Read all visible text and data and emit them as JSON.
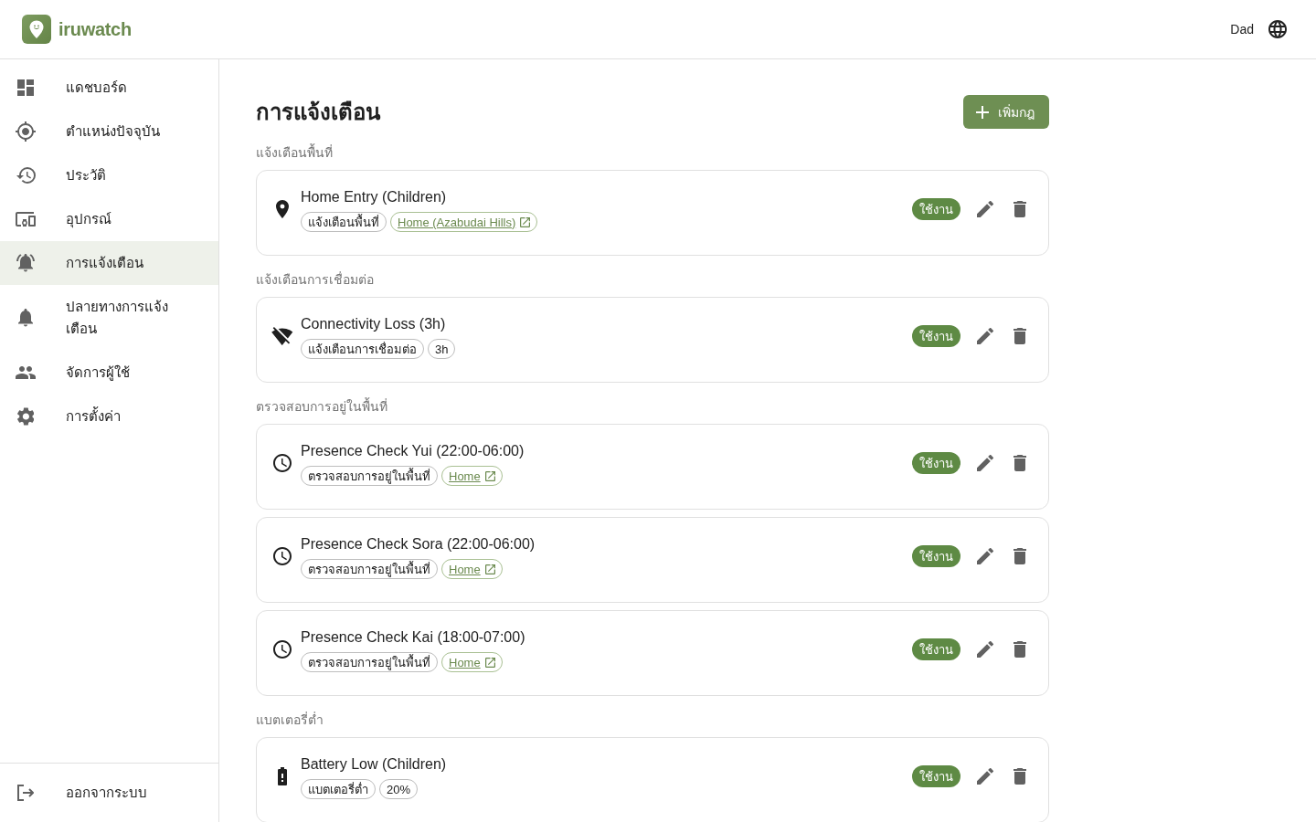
{
  "header": {
    "brand": "iruwatch",
    "user": "Dad"
  },
  "sidebar": {
    "items": [
      {
        "label": "แดชบอร์ด",
        "selected": false
      },
      {
        "label": "ตำแหน่งปัจจุบัน",
        "selected": false
      },
      {
        "label": "ประวัติ",
        "selected": false
      },
      {
        "label": "อุปกรณ์",
        "selected": false
      },
      {
        "label": "การแจ้งเตือน",
        "selected": true
      },
      {
        "label": "ปลายทางการแจ้งเตือน",
        "selected": false
      },
      {
        "label": "จัดการผู้ใช้",
        "selected": false
      },
      {
        "label": "การตั้งค่า",
        "selected": false
      }
    ],
    "logout": "ออกจากระบบ"
  },
  "page": {
    "title": "การแจ้งเตือน",
    "add_button": "เพิ่มกฎ"
  },
  "sections": [
    {
      "heading": "แจ้งเตือนพื้นที่",
      "rules": [
        {
          "kind": "geofence",
          "title": "Home Entry (Children)",
          "tags": [
            {
              "kind": "plain",
              "text": "แจ้งเตือนพื้นที่"
            },
            {
              "kind": "link",
              "text": "Home (Azabudai Hills)"
            }
          ],
          "status": {
            "label": "ใช้งาน",
            "on": true
          }
        }
      ]
    },
    {
      "heading": "แจ้งเตือนการเชื่อมต่อ",
      "rules": [
        {
          "kind": "connectivity",
          "title": "Connectivity Loss (3h)",
          "tags": [
            {
              "kind": "plain",
              "text": "แจ้งเตือนการเชื่อมต่อ"
            },
            {
              "kind": "plain",
              "text": "3h"
            }
          ],
          "status": {
            "label": "ใช้งาน",
            "on": true
          }
        }
      ]
    },
    {
      "heading": "ตรวจสอบการอยู่ในพื้นที่",
      "rules": [
        {
          "kind": "presence",
          "title": "Presence Check Yui (22:00-06:00)",
          "tags": [
            {
              "kind": "plain",
              "text": "ตรวจสอบการอยู่ในพื้นที่"
            },
            {
              "kind": "link",
              "text": "Home"
            }
          ],
          "status": {
            "label": "ใช้งาน",
            "on": true
          }
        },
        {
          "kind": "presence",
          "title": "Presence Check Sora (22:00-06:00)",
          "tags": [
            {
              "kind": "plain",
              "text": "ตรวจสอบการอยู่ในพื้นที่"
            },
            {
              "kind": "link",
              "text": "Home"
            }
          ],
          "status": {
            "label": "ใช้งาน",
            "on": true
          }
        },
        {
          "kind": "presence",
          "title": "Presence Check Kai (18:00-07:00)",
          "tags": [
            {
              "kind": "plain",
              "text": "ตรวจสอบการอยู่ในพื้นที่"
            },
            {
              "kind": "link",
              "text": "Home"
            }
          ],
          "status": {
            "label": "ใช้งาน",
            "on": true
          }
        }
      ]
    },
    {
      "heading": "แบตเตอรี่ต่ำ",
      "rules": [
        {
          "kind": "battery",
          "title": "Battery Low (Children)",
          "tags": [
            {
              "kind": "plain",
              "text": "แบตเตอรี่ต่ำ"
            },
            {
              "kind": "plain",
              "text": "20%"
            }
          ],
          "status": {
            "label": "ใช้งาน",
            "on": true
          }
        }
      ]
    }
  ]
}
